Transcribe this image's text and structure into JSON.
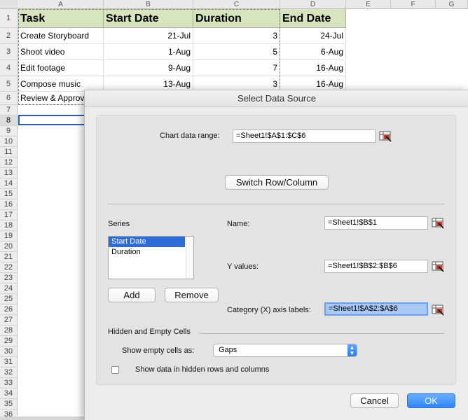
{
  "sheet": {
    "columns": [
      "A",
      "B",
      "C",
      "D",
      "E",
      "F",
      "G"
    ],
    "rows": [
      "1",
      "2",
      "3",
      "4",
      "5",
      "6",
      "7",
      "8",
      "9",
      "10",
      "11",
      "12",
      "13",
      "14",
      "15",
      "16",
      "17",
      "18",
      "19",
      "20",
      "21",
      "22",
      "23",
      "24",
      "25",
      "26",
      "27",
      "28",
      "29",
      "30",
      "31",
      "32",
      "33",
      "34",
      "35",
      "36"
    ],
    "headers": {
      "task": "Task",
      "start": "Start Date",
      "duration": "Duration",
      "end": "End Date"
    },
    "data": [
      {
        "task": "Create Storyboard",
        "start": "21-Jul",
        "duration": "3",
        "end": "24-Jul"
      },
      {
        "task": "Shoot video",
        "start": "1-Aug",
        "duration": "5",
        "end": "6-Aug"
      },
      {
        "task": "Edit footage",
        "start": "9-Aug",
        "duration": "7",
        "end": "16-Aug"
      },
      {
        "task": "Compose music",
        "start": "13-Aug",
        "duration": "3",
        "end": "16-Aug"
      },
      {
        "task": "Review & Approva",
        "start": "",
        "duration": "",
        "end": ""
      }
    ],
    "selected_row": "8"
  },
  "dialog": {
    "title": "Select Data Source",
    "chart_range_label": "Chart data range:",
    "chart_range_value": "=Sheet1!$A$1:$C$6",
    "switch_button": "Switch Row/Column",
    "series_label": "Series",
    "series_items": [
      "Start Date",
      "Duration"
    ],
    "name_label": "Name:",
    "name_value": "=Sheet1!$B$1",
    "yvalues_label": "Y values:",
    "yvalues_value": "=Sheet1!$B$2:$B$6",
    "category_label": "Category (X) axis labels:",
    "category_value": "=Sheet1!$A$2:$A$6",
    "add_button": "Add",
    "remove_button": "Remove",
    "hidden_section_label": "Hidden and Empty Cells",
    "show_empty_label": "Show empty cells as:",
    "show_empty_value": "Gaps",
    "hidden_rows_label": "Show data in hidden rows and columns",
    "cancel_button": "Cancel",
    "ok_button": "OK"
  },
  "colors": {
    "header_fill": "#d7e4bd",
    "selection_blue": "#2d6bd6",
    "ok_button": "#2f86f7"
  },
  "icons": {
    "range_picker": "range-selector-icon",
    "dropdown": "chevron-up-down-icon"
  }
}
